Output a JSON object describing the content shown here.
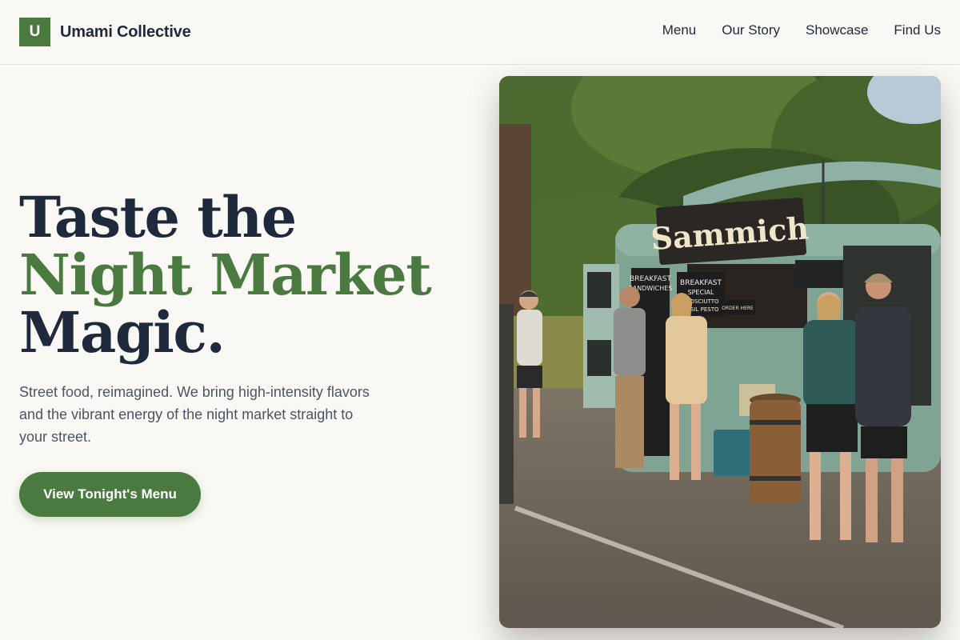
{
  "brand": {
    "mark": "U",
    "name": "Umami Collective"
  },
  "nav": {
    "items": [
      "Menu",
      "Our Story",
      "Showcase",
      "Find Us"
    ]
  },
  "hero": {
    "headline": [
      "Taste the",
      "Night Market",
      "Magic."
    ],
    "subcopy": "Street food, reimagined. We bring high-intensity flavors and the vibrant energy of the night market straight to your street.",
    "cta": "View Tonight's Menu"
  },
  "photo": {
    "truck_sign": "Sammich",
    "board_left": [
      "BREAKFAST",
      "SANDWICHES"
    ],
    "board_right": [
      "BREAKFAST",
      "SPECIAL",
      "PROSCIUTTO",
      "BASIL PESTO"
    ],
    "small_sign": "ORDER HERE"
  },
  "colors": {
    "accent": "#4a7a3f",
    "ink": "#1e293b",
    "background": "#f9f8f4"
  }
}
